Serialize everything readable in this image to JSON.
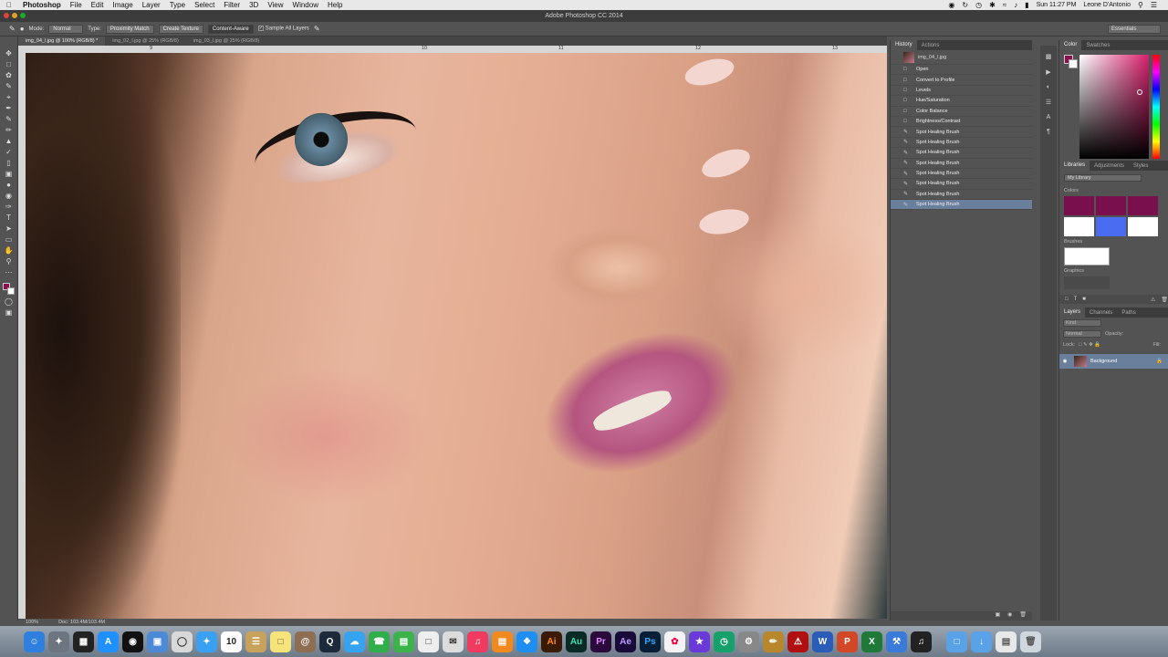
{
  "menubar": {
    "app_name": "Photoshop",
    "menus": [
      "File",
      "Edit",
      "Image",
      "Layer",
      "Type",
      "Select",
      "Filter",
      "3D",
      "View",
      "Window",
      "Help"
    ],
    "clock": "Sun 11:27 PM",
    "user": "Leone D'Antonio"
  },
  "window": {
    "title": "Adobe Photoshop CC 2014"
  },
  "options_bar": {
    "mode_label": "Mode:",
    "mode_value": "Normal",
    "type_label": "Type:",
    "type_options": [
      "Proximity Match",
      "Create Texture",
      "Content-Aware"
    ],
    "selected_type": "Content-Aware",
    "sample_all_layers": "Sample All Layers",
    "workspace": "Essentials"
  },
  "doc_tabs": [
    {
      "label": "img_04_l.jpg @ 100% (RGB/8) *",
      "active": true
    },
    {
      "label": "img_02_l.jpg @ 25% (RGB/8)",
      "active": false
    },
    {
      "label": "img_03_l.jpg @ 25% (RGB/8)",
      "active": false
    }
  ],
  "ruler": {
    "marks": [
      "9",
      "10",
      "11",
      "12",
      "13"
    ]
  },
  "status": {
    "zoom": "100%",
    "doc": "Doc: 103.4M/103.4M"
  },
  "history_panel": {
    "tabs": [
      "History",
      "Actions"
    ],
    "snapshot": "img_04_l.jpg",
    "items": [
      "Open",
      "Convert to Profile",
      "Levels",
      "Hue/Saturation",
      "Color Balance",
      "Brightness/Contrast",
      "Spot Healing Brush",
      "Spot Healing Brush",
      "Spot Healing Brush",
      "Spot Healing Brush",
      "Spot Healing Brush",
      "Spot Healing Brush",
      "Spot Healing Brush",
      "Spot Healing Brush"
    ],
    "selected_index": 13
  },
  "color_panel": {
    "tabs": [
      "Color",
      "Swatches"
    ],
    "foreground": "#8a1050",
    "background": "#ffffff"
  },
  "libraries_panel": {
    "tabs": [
      "Libraries",
      "Adjustments",
      "Styles"
    ],
    "library": "My Library",
    "colors_label": "Colors",
    "colors": [
      "#7a0f4e",
      "#7a0f4e",
      "#7a0f4e",
      "#ffffff",
      "#4a6cf0",
      "#ffffff"
    ],
    "brushes_label": "Brushes",
    "graphics_label": "Graphics"
  },
  "layers_panel": {
    "tabs": [
      "Layers",
      "Channels",
      "Paths"
    ],
    "filter": "Kind",
    "blend": "Normal",
    "opacity_label": "Opacity:",
    "lock_label": "Lock:",
    "fill_label": "Fill:",
    "layer_name": "Background"
  },
  "dock": {
    "apps": [
      "Finder",
      "Launchpad",
      "Mission Control",
      "App Store",
      "Dashboard",
      "Preview",
      "System",
      "Twitter",
      "Calendar",
      "Notes",
      "Stickies",
      "Contacts",
      "QuickTime",
      "Messages",
      "FaceTime",
      "Numbers",
      "Keynote",
      "Mail",
      "iTunes",
      "iBooks",
      "Safari",
      "Ai",
      "Au",
      "Pr",
      "Ae",
      "Ps",
      "Photos",
      "iMovie",
      "Time Machine",
      "Preferences",
      "Pencil",
      "PDF",
      "W",
      "P",
      "X",
      "Tools",
      "Piano",
      "Folder",
      "Downloads",
      "Files",
      "Trash"
    ],
    "calendar_day": "10"
  }
}
